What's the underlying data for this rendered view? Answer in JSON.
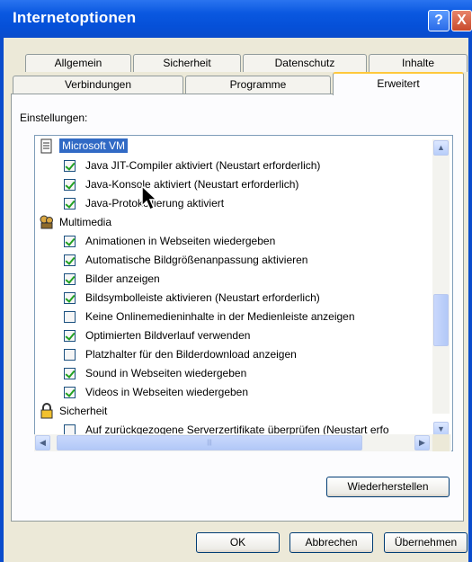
{
  "window": {
    "title": "Internetoptionen",
    "help_glyph": "?",
    "close_glyph": "X"
  },
  "tabs_row1": [
    {
      "label": "Allgemein"
    },
    {
      "label": "Sicherheit"
    },
    {
      "label": "Datenschutz"
    },
    {
      "label": "Inhalte"
    }
  ],
  "tabs_row2": [
    {
      "label": "Verbindungen"
    },
    {
      "label": "Programme"
    },
    {
      "label": "Erweitert",
      "active": true
    }
  ],
  "settings": {
    "label": "Einstellungen:",
    "rows": [
      {
        "type": "category",
        "icon": "page-icon",
        "label": "Microsoft VM",
        "selected": true
      },
      {
        "type": "checkbox",
        "checked": true,
        "label": "Java JIT-Compiler aktiviert (Neustart erforderlich)"
      },
      {
        "type": "checkbox",
        "checked": true,
        "label": "Java-Konsole aktiviert (Neustart erforderlich)"
      },
      {
        "type": "checkbox",
        "checked": true,
        "label": "Java-Protokollierung aktiviert"
      },
      {
        "type": "category",
        "icon": "multimedia-icon",
        "label": "Multimedia"
      },
      {
        "type": "checkbox",
        "checked": true,
        "label": "Animationen in Webseiten wiedergeben"
      },
      {
        "type": "checkbox",
        "checked": true,
        "label": "Automatische Bildgrößenanpassung aktivieren"
      },
      {
        "type": "checkbox",
        "checked": true,
        "label": "Bilder anzeigen"
      },
      {
        "type": "checkbox",
        "checked": true,
        "label": "Bildsymbolleiste aktivieren (Neustart erforderlich)"
      },
      {
        "type": "checkbox",
        "checked": false,
        "label": "Keine Onlinemedieninhalte in der Medienleiste anzeigen"
      },
      {
        "type": "checkbox",
        "checked": true,
        "label": "Optimierten Bildverlauf verwenden"
      },
      {
        "type": "checkbox",
        "checked": false,
        "label": "Platzhalter für den Bilderdownload anzeigen"
      },
      {
        "type": "checkbox",
        "checked": true,
        "label": "Sound in Webseiten wiedergeben"
      },
      {
        "type": "checkbox",
        "checked": true,
        "label": "Videos in Webseiten wiedergeben"
      },
      {
        "type": "category",
        "icon": "lock-icon",
        "label": "Sicherheit"
      },
      {
        "type": "checkbox",
        "checked": false,
        "label": "Auf zurückgezogene Serverzertifikate überprüfen (Neustart erfo"
      }
    ]
  },
  "buttons": {
    "restore": "Wiederherstellen",
    "ok": "OK",
    "cancel": "Abbrechen",
    "apply": "Übernehmen"
  },
  "colors": {
    "titlebar": "#0a4ccc",
    "selection": "#316ac5",
    "check": "#21a121"
  }
}
